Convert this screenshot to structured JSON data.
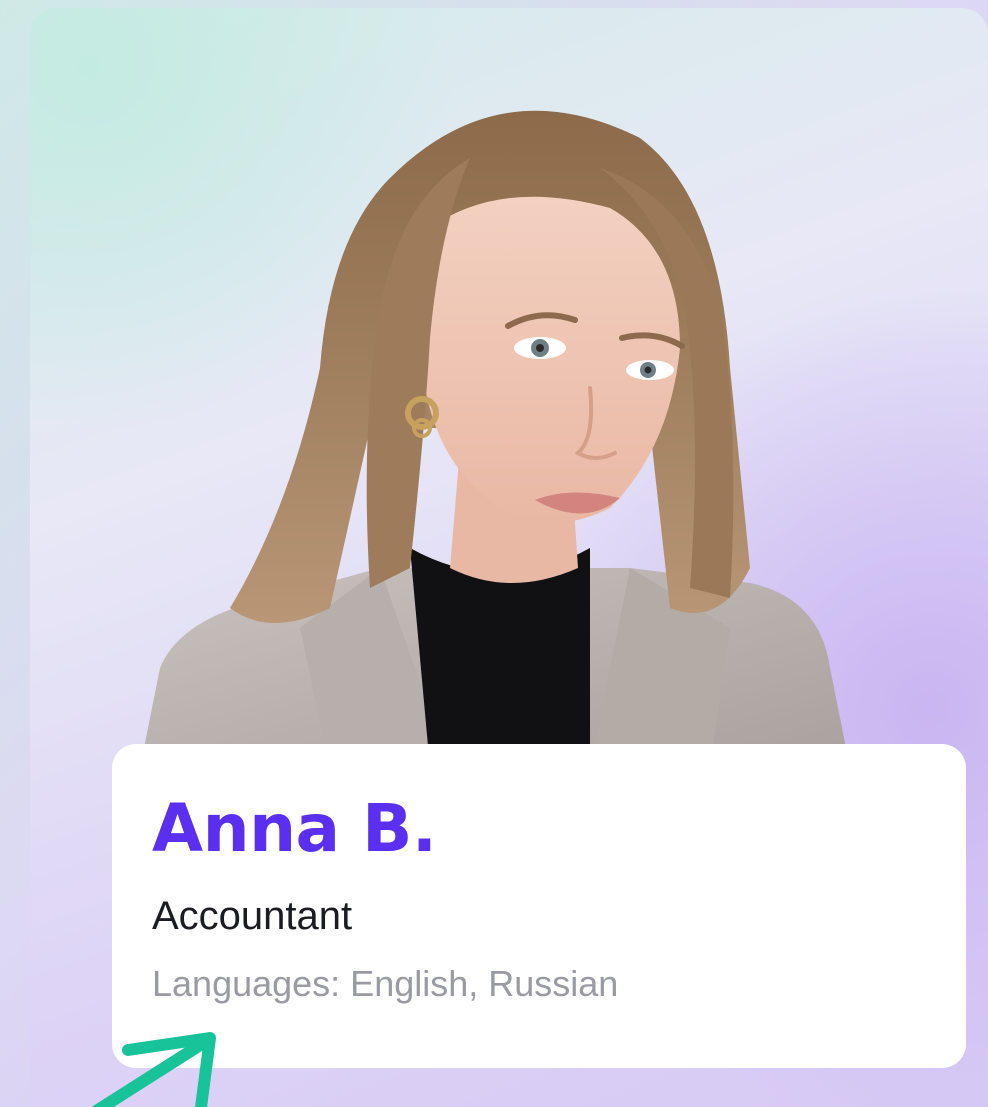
{
  "profile": {
    "name": "Anna B.",
    "role": "Accountant",
    "languages": "Languages: English, Russian"
  },
  "colors": {
    "name_accent": "#5b2ff0",
    "arrow": "#19c39a"
  },
  "icons": {
    "arrow": "arrow-pointer-icon"
  }
}
